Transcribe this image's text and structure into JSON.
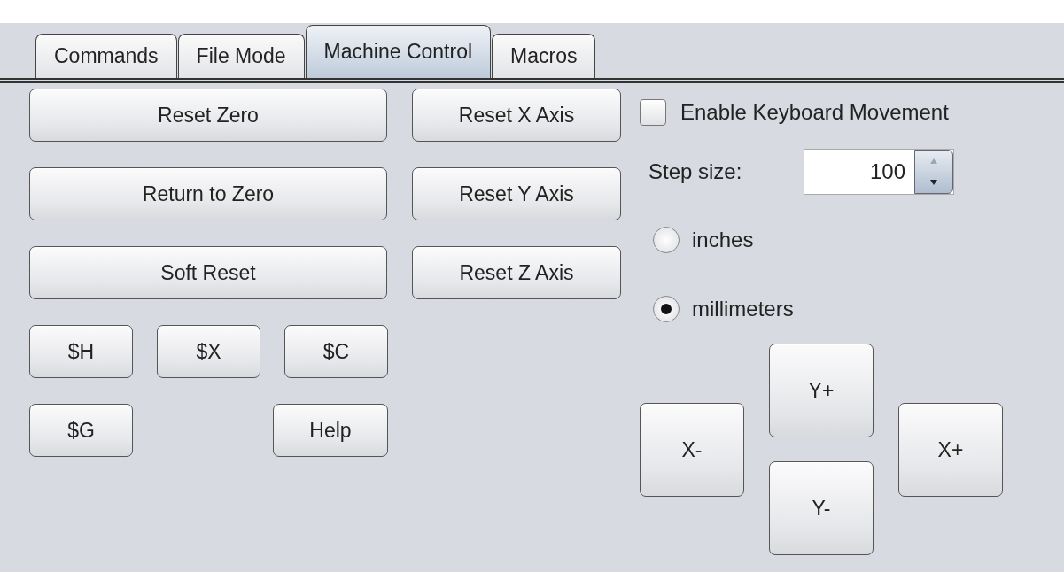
{
  "tabs": [
    {
      "label": "Commands",
      "selected": false
    },
    {
      "label": "File Mode",
      "selected": false
    },
    {
      "label": "Machine Control",
      "selected": true
    },
    {
      "label": "Macros",
      "selected": false
    }
  ],
  "main_buttons": [
    "Reset Zero",
    "Return to Zero",
    "Soft Reset"
  ],
  "axis_buttons": [
    "Reset X Axis",
    "Reset Y Axis",
    "Reset Z Axis"
  ],
  "command_buttons": [
    [
      "$H",
      "$X",
      "$C"
    ],
    [
      "$G",
      "Help"
    ]
  ],
  "keyboard_movement": {
    "label": "Enable Keyboard Movement",
    "checked": false
  },
  "step_size": {
    "label": "Step size:",
    "value": "100"
  },
  "units": [
    {
      "label": "inches",
      "selected": false
    },
    {
      "label": "millimeters",
      "selected": true
    }
  ],
  "jog": {
    "y_plus": "Y+",
    "x_minus": "X-",
    "x_plus": "X+",
    "y_minus": "Y-"
  }
}
